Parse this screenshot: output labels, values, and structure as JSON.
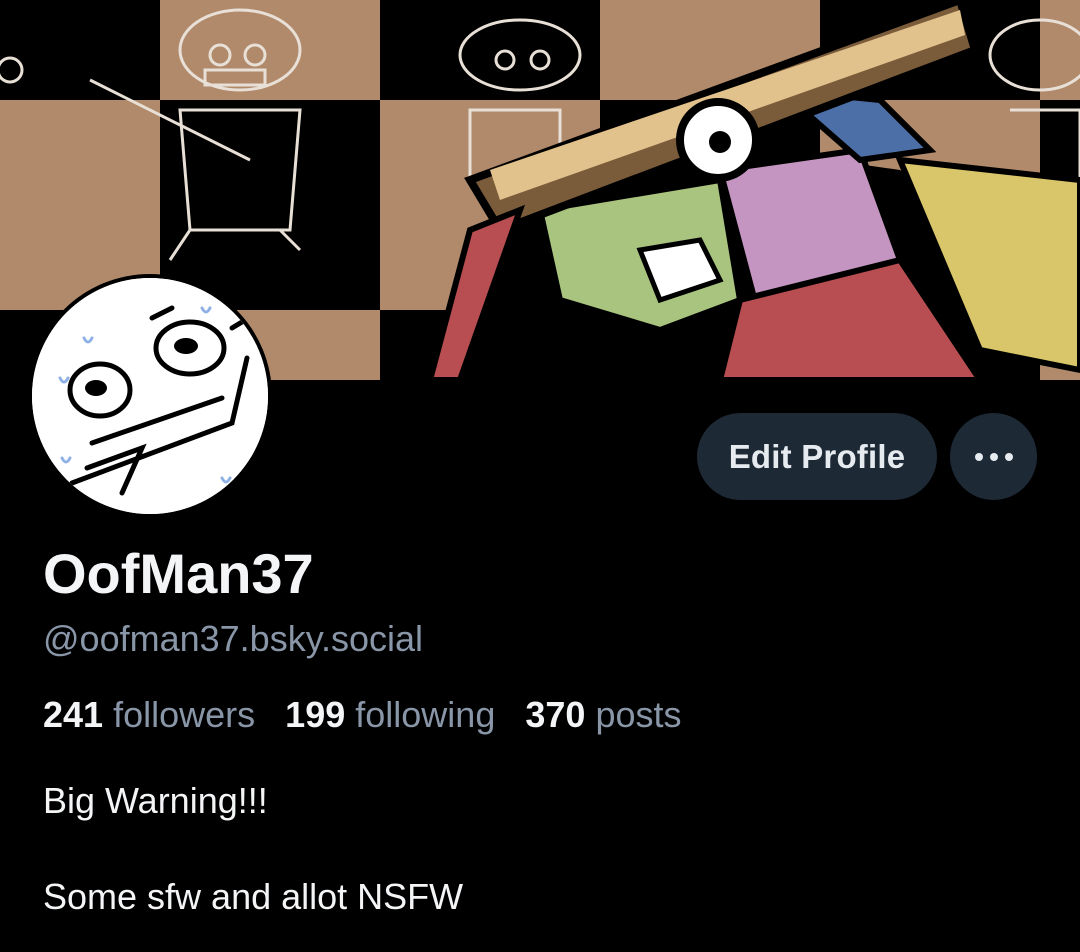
{
  "profile": {
    "display_name": "OofMan37",
    "handle": "@oofman37.bsky.social",
    "bio": [
      "Big Warning!!!",
      "Some sfw and allot NSFW"
    ]
  },
  "stats": {
    "followers": {
      "count": "241",
      "label": "followers"
    },
    "following": {
      "count": "199",
      "label": "following"
    },
    "posts": {
      "count": "370",
      "label": "posts"
    }
  },
  "actions": {
    "edit_profile_label": "Edit Profile",
    "more_label": "•••"
  },
  "colors": {
    "background": "#000000",
    "button_bg": "#1e2936",
    "muted_text": "#8996a8",
    "banner_tan": "#b08a6a"
  },
  "icons": {
    "more": "ellipsis-icon"
  }
}
